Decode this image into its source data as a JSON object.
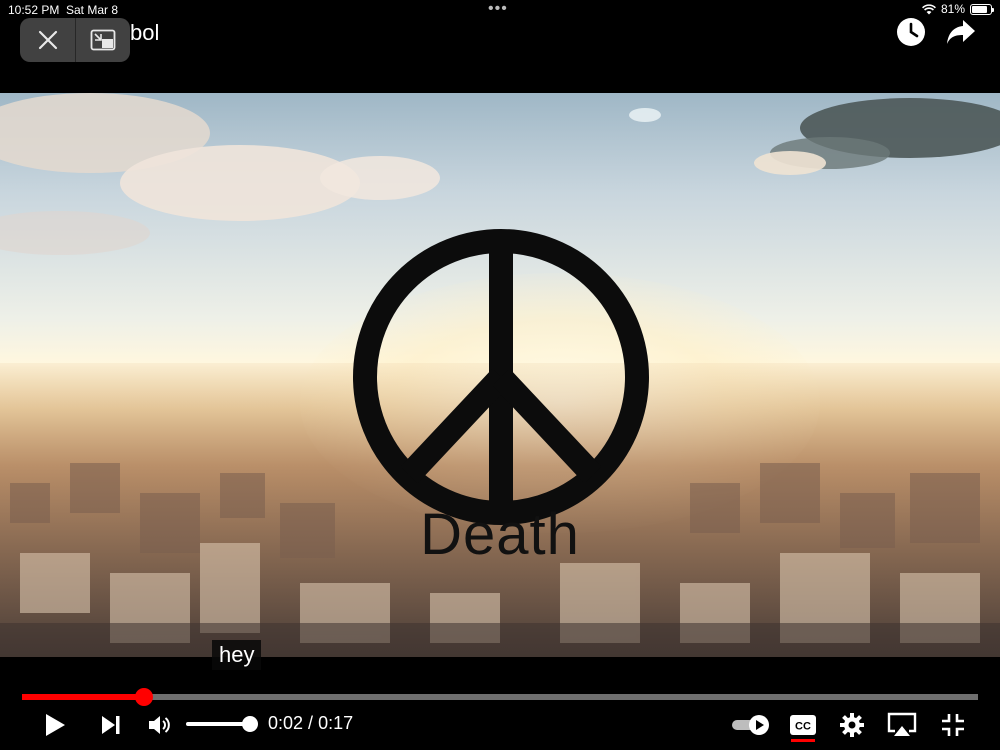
{
  "status_bar": {
    "time": "10:52 PM",
    "date": "Sat Mar 8",
    "battery_percent": "81%",
    "battery_level": 0.81
  },
  "header": {
    "title": "bol",
    "pip_close_icon": "close-icon",
    "pip_expand_icon": "picture-in-picture-icon",
    "watch_later_icon": "clock-icon",
    "share_icon": "share-arrow-icon"
  },
  "video": {
    "overlay_word": "Death",
    "subtitle": "hey"
  },
  "player": {
    "current_time": "0:02",
    "duration": "0:17",
    "time_display": "0:02 / 0:17",
    "progress_fraction": 0.1276,
    "volume_fraction": 1.0,
    "accent_color": "#ff0000"
  }
}
